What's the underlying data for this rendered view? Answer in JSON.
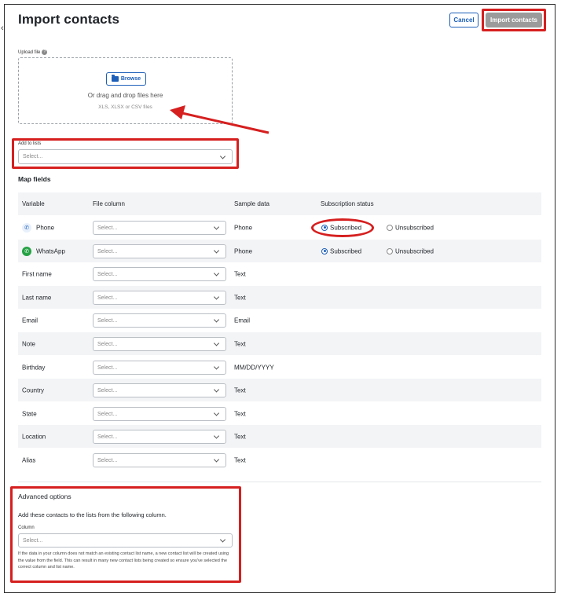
{
  "header": {
    "title": "Import contacts",
    "cancel_label": "Cancel",
    "import_label": "Import contacts"
  },
  "upload": {
    "label": "Upload file",
    "help_icon": "?",
    "browse_label": "Browse",
    "drop_text": "Or drag and drop files here",
    "hint": "XLS, XLSX or CSV files"
  },
  "lists": {
    "label": "Add to lists",
    "placeholder": "Select..."
  },
  "map_fields": {
    "title": "Map fields",
    "columns": [
      "Variable",
      "File column",
      "Sample data",
      "Subscription status"
    ],
    "rows": [
      {
        "variable": "Phone",
        "icon": "phone-icon",
        "file_column": "Select...",
        "sample": "Phone",
        "subscribed": "Subscribed",
        "unsubscribed": "Unsubscribed",
        "selected": "subscribed"
      },
      {
        "variable": "WhatsApp",
        "icon": "whatsapp-icon",
        "file_column": "Select...",
        "sample": "Phone",
        "subscribed": "Subscribed",
        "unsubscribed": "Unsubscribed",
        "selected": "subscribed"
      },
      {
        "variable": "First name",
        "file_column": "Select...",
        "sample": "Text"
      },
      {
        "variable": "Last name",
        "file_column": "Select...",
        "sample": "Text"
      },
      {
        "variable": "Email",
        "file_column": "Select...",
        "sample": "Email"
      },
      {
        "variable": "Note",
        "file_column": "Select...",
        "sample": "Text"
      },
      {
        "variable": "Birthday",
        "file_column": "Select...",
        "sample": "MM/DD/YYYY"
      },
      {
        "variable": "Country",
        "file_column": "Select...",
        "sample": "Text"
      },
      {
        "variable": "State",
        "file_column": "Select...",
        "sample": "Text"
      },
      {
        "variable": "Location",
        "file_column": "Select...",
        "sample": "Text"
      },
      {
        "variable": "Alias",
        "file_column": "Select...",
        "sample": "Text"
      }
    ]
  },
  "advanced": {
    "title": "Advanced options",
    "description": "Add these contacts to the lists from the following column.",
    "column_label": "Column",
    "placeholder": "Select...",
    "note": "If the data in your column does not match an existing contact list name, a new contact list will be created using the value from the field. This can result in many new contact lists being created so ensure you've selected the correct column and list name."
  },
  "colors": {
    "accent": "#1d5fb8",
    "annotation": "#d61f1f",
    "whatsapp": "#25a244",
    "disabled_button": "#9b9b9b"
  }
}
